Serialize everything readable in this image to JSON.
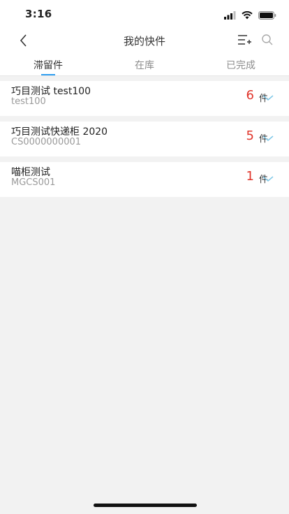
{
  "status": {
    "time": "3:16"
  },
  "nav": {
    "title": "我的快件"
  },
  "tabs": [
    {
      "label": "滞留件",
      "active": true
    },
    {
      "label": "在库",
      "active": false
    },
    {
      "label": "已完成",
      "active": false
    }
  ],
  "items": [
    {
      "name": "巧目测试 test100",
      "code": "test100",
      "count": "6",
      "unit": "件"
    },
    {
      "name": "巧目测试快递柜 2020",
      "code": "CS0000000001",
      "count": "5",
      "unit": "件"
    },
    {
      "name": "喵柜测试",
      "code": "MGCS001",
      "count": "1",
      "unit": "件"
    }
  ],
  "colors": {
    "accent": "#2f9ef0",
    "count": "#e0342a",
    "chevron": "#7fc8e8"
  },
  "icons": [
    "back-icon",
    "add-list-icon",
    "search-icon",
    "chevron-down-icon"
  ]
}
